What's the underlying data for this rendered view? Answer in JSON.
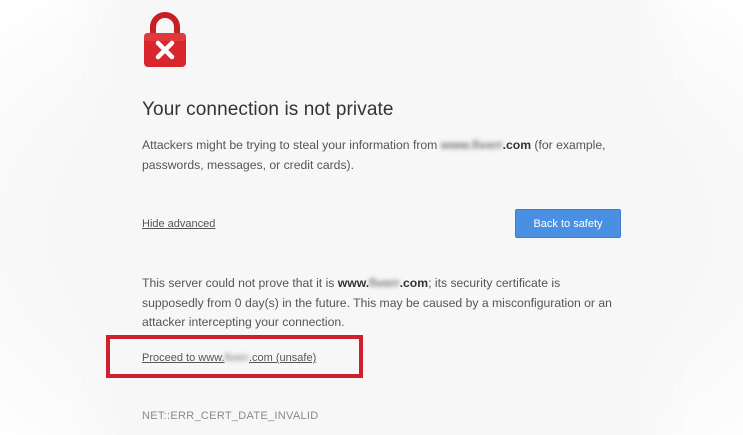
{
  "interstitial": {
    "title": "Your connection is not private",
    "intro": {
      "before": "Attackers might be trying to steal your information from ",
      "domain_blurred": "www.fiverr",
      "domain_suffix": ".com",
      "after": " (for example, passwords, messages, or credit cards)."
    },
    "hide_advanced_label": "Hide advanced",
    "back_button_label": "Back to safety",
    "details": {
      "before": "This server could not prove that it is ",
      "domain_prefix": "www.",
      "domain_blurred": "fiverr",
      "domain_suffix": ".com",
      "after": "; its security certificate is supposedly from 0 day(s) in the future. This may be caused by a misconfiguration or an attacker intercepting your connection."
    },
    "proceed": {
      "before": "Proceed to www.",
      "domain_blurred": "fiverr",
      "after": ".com (unsafe)"
    },
    "error_code": "NET::ERR_CERT_DATE_INVALID"
  },
  "icons": {
    "lock": "lock-error-icon"
  },
  "colors": {
    "lock_red": "#d9262c",
    "button_blue": "#4a90e2",
    "highlight_red": "#d0202e"
  }
}
